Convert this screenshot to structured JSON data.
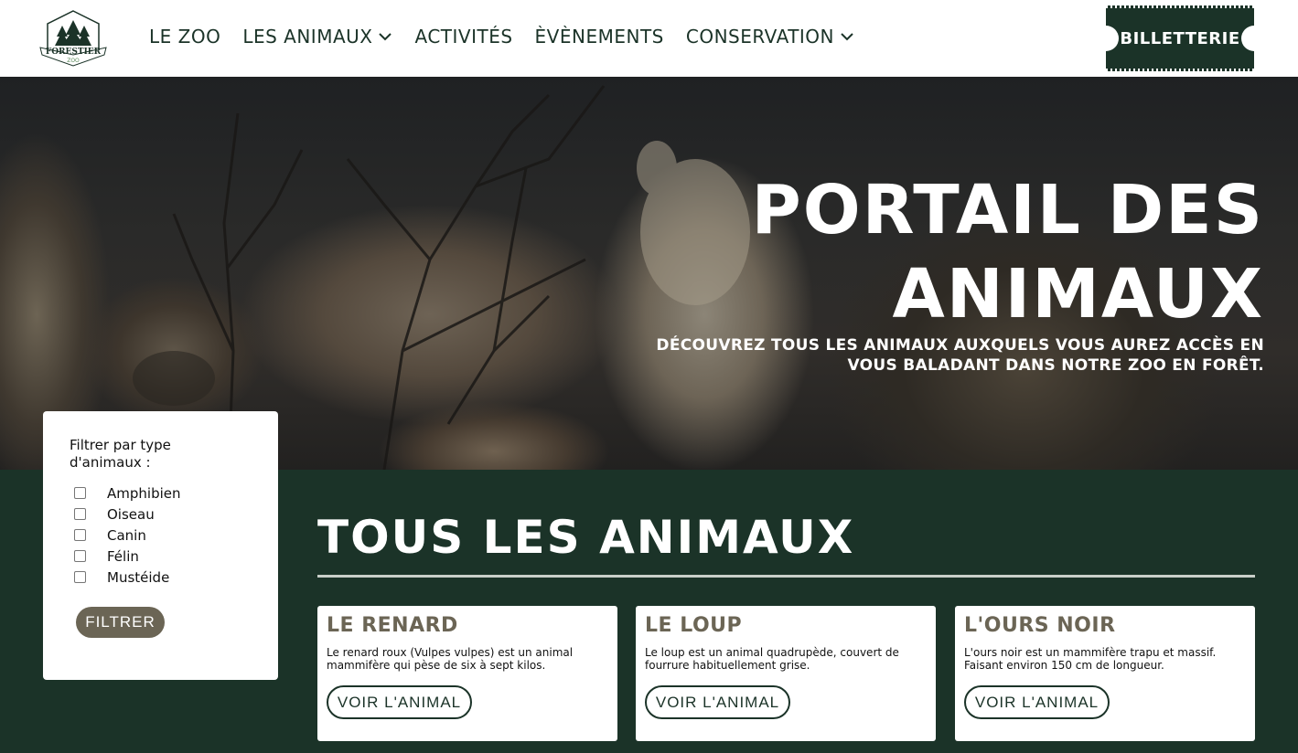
{
  "header": {
    "logo": {
      "name": "FORESTIER",
      "sub": "ZOO"
    },
    "nav": [
      {
        "label": "LE ZOO",
        "dropdown": false
      },
      {
        "label": "LES ANIMAUX",
        "dropdown": true
      },
      {
        "label": "ACTIVITÉS",
        "dropdown": false
      },
      {
        "label": "ÈVÈNEMENTS",
        "dropdown": false
      },
      {
        "label": "CONSERVATION",
        "dropdown": true
      }
    ],
    "ticket_label": "BILLETTERIE"
  },
  "hero": {
    "title": "PORTAIL DES ANIMAUX",
    "subtitle": "DÉCOUVREZ TOUS LES ANIMAUX AUXQUELS VOUS AUREZ ACCÈS EN VOUS BALADANT DANS NOTRE ZOO EN FORÊT."
  },
  "filter": {
    "title": "Filtrer par type d'animaux :",
    "options": [
      "Amphibien",
      "Oiseau",
      "Canin",
      "Félin",
      "Mustéide"
    ],
    "button": "FILTRER"
  },
  "main": {
    "title": "TOUS LES ANIMAUX",
    "cards": [
      {
        "title": "LE RENARD",
        "text": "Le renard roux (Vulpes vulpes) est un animal mammifère qui pèse de six à sept kilos.",
        "button": "VOIR L'ANIMAL"
      },
      {
        "title": "LE LOUP",
        "text": "Le loup est un animal quadrupède, couvert de fourrure habituellement grise.",
        "button": "VOIR L'ANIMAL"
      },
      {
        "title": "L'OURS NOIR",
        "text": "L'ours noir est un mammifère trapu et massif. Faisant environ 150 cm de longueur.",
        "button": "VOIR L'ANIMAL"
      }
    ]
  },
  "colors": {
    "brand_green": "#1b3328",
    "accent_olive": "#6b6555",
    "white": "#ffffff"
  },
  "icons": [
    "tree-logo-icon",
    "chevron-down-icon"
  ]
}
